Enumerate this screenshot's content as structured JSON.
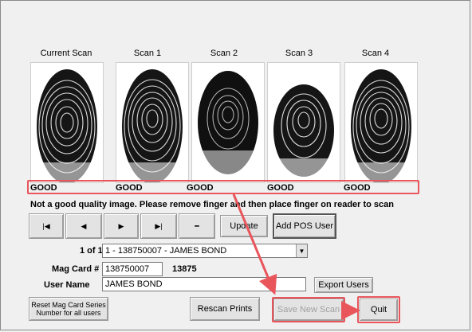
{
  "scans": [
    {
      "label": "Current Scan",
      "quality": "GOOD"
    },
    {
      "label": "Scan 1",
      "quality": "GOOD"
    },
    {
      "label": "Scan 2",
      "quality": "GOOD"
    },
    {
      "label": "Scan 3",
      "quality": "GOOD"
    },
    {
      "label": "Scan 4",
      "quality": "GOOD"
    }
  ],
  "message": "Not a good quality image.  Please remove finger and then place finger on reader to scan",
  "nav": {
    "first_icon": "first-record-icon",
    "first": "|◀",
    "prev_icon": "previous-record-icon",
    "prev": "◀",
    "next_icon": "next-record-icon",
    "next": "▶",
    "last_icon": "last-record-icon",
    "last": "▶|",
    "delete_icon": "delete-record-icon",
    "delete": "━"
  },
  "buttons": {
    "update": "Update",
    "add_pos_user": "Add POS User",
    "export_users": "Export Users",
    "reset_mag_line1": "Reset Mag Card Series",
    "reset_mag_line2": "Number for all users",
    "rescan_prints": "Rescan Prints",
    "save_new_scan": "Save New Scan",
    "quit": "Quit"
  },
  "record": {
    "position": "1 of 1",
    "selected_user": "1 - 138750007 - JAMES BOND",
    "mag_card_label": "Mag Card #",
    "mag_card_value": "138750007",
    "mag_card_short": "13875",
    "user_name_label": "User Name",
    "user_name_value": "JAMES BOND"
  },
  "colors": {
    "highlight": "#e8565c",
    "window_bg": "#f0f0f0"
  }
}
